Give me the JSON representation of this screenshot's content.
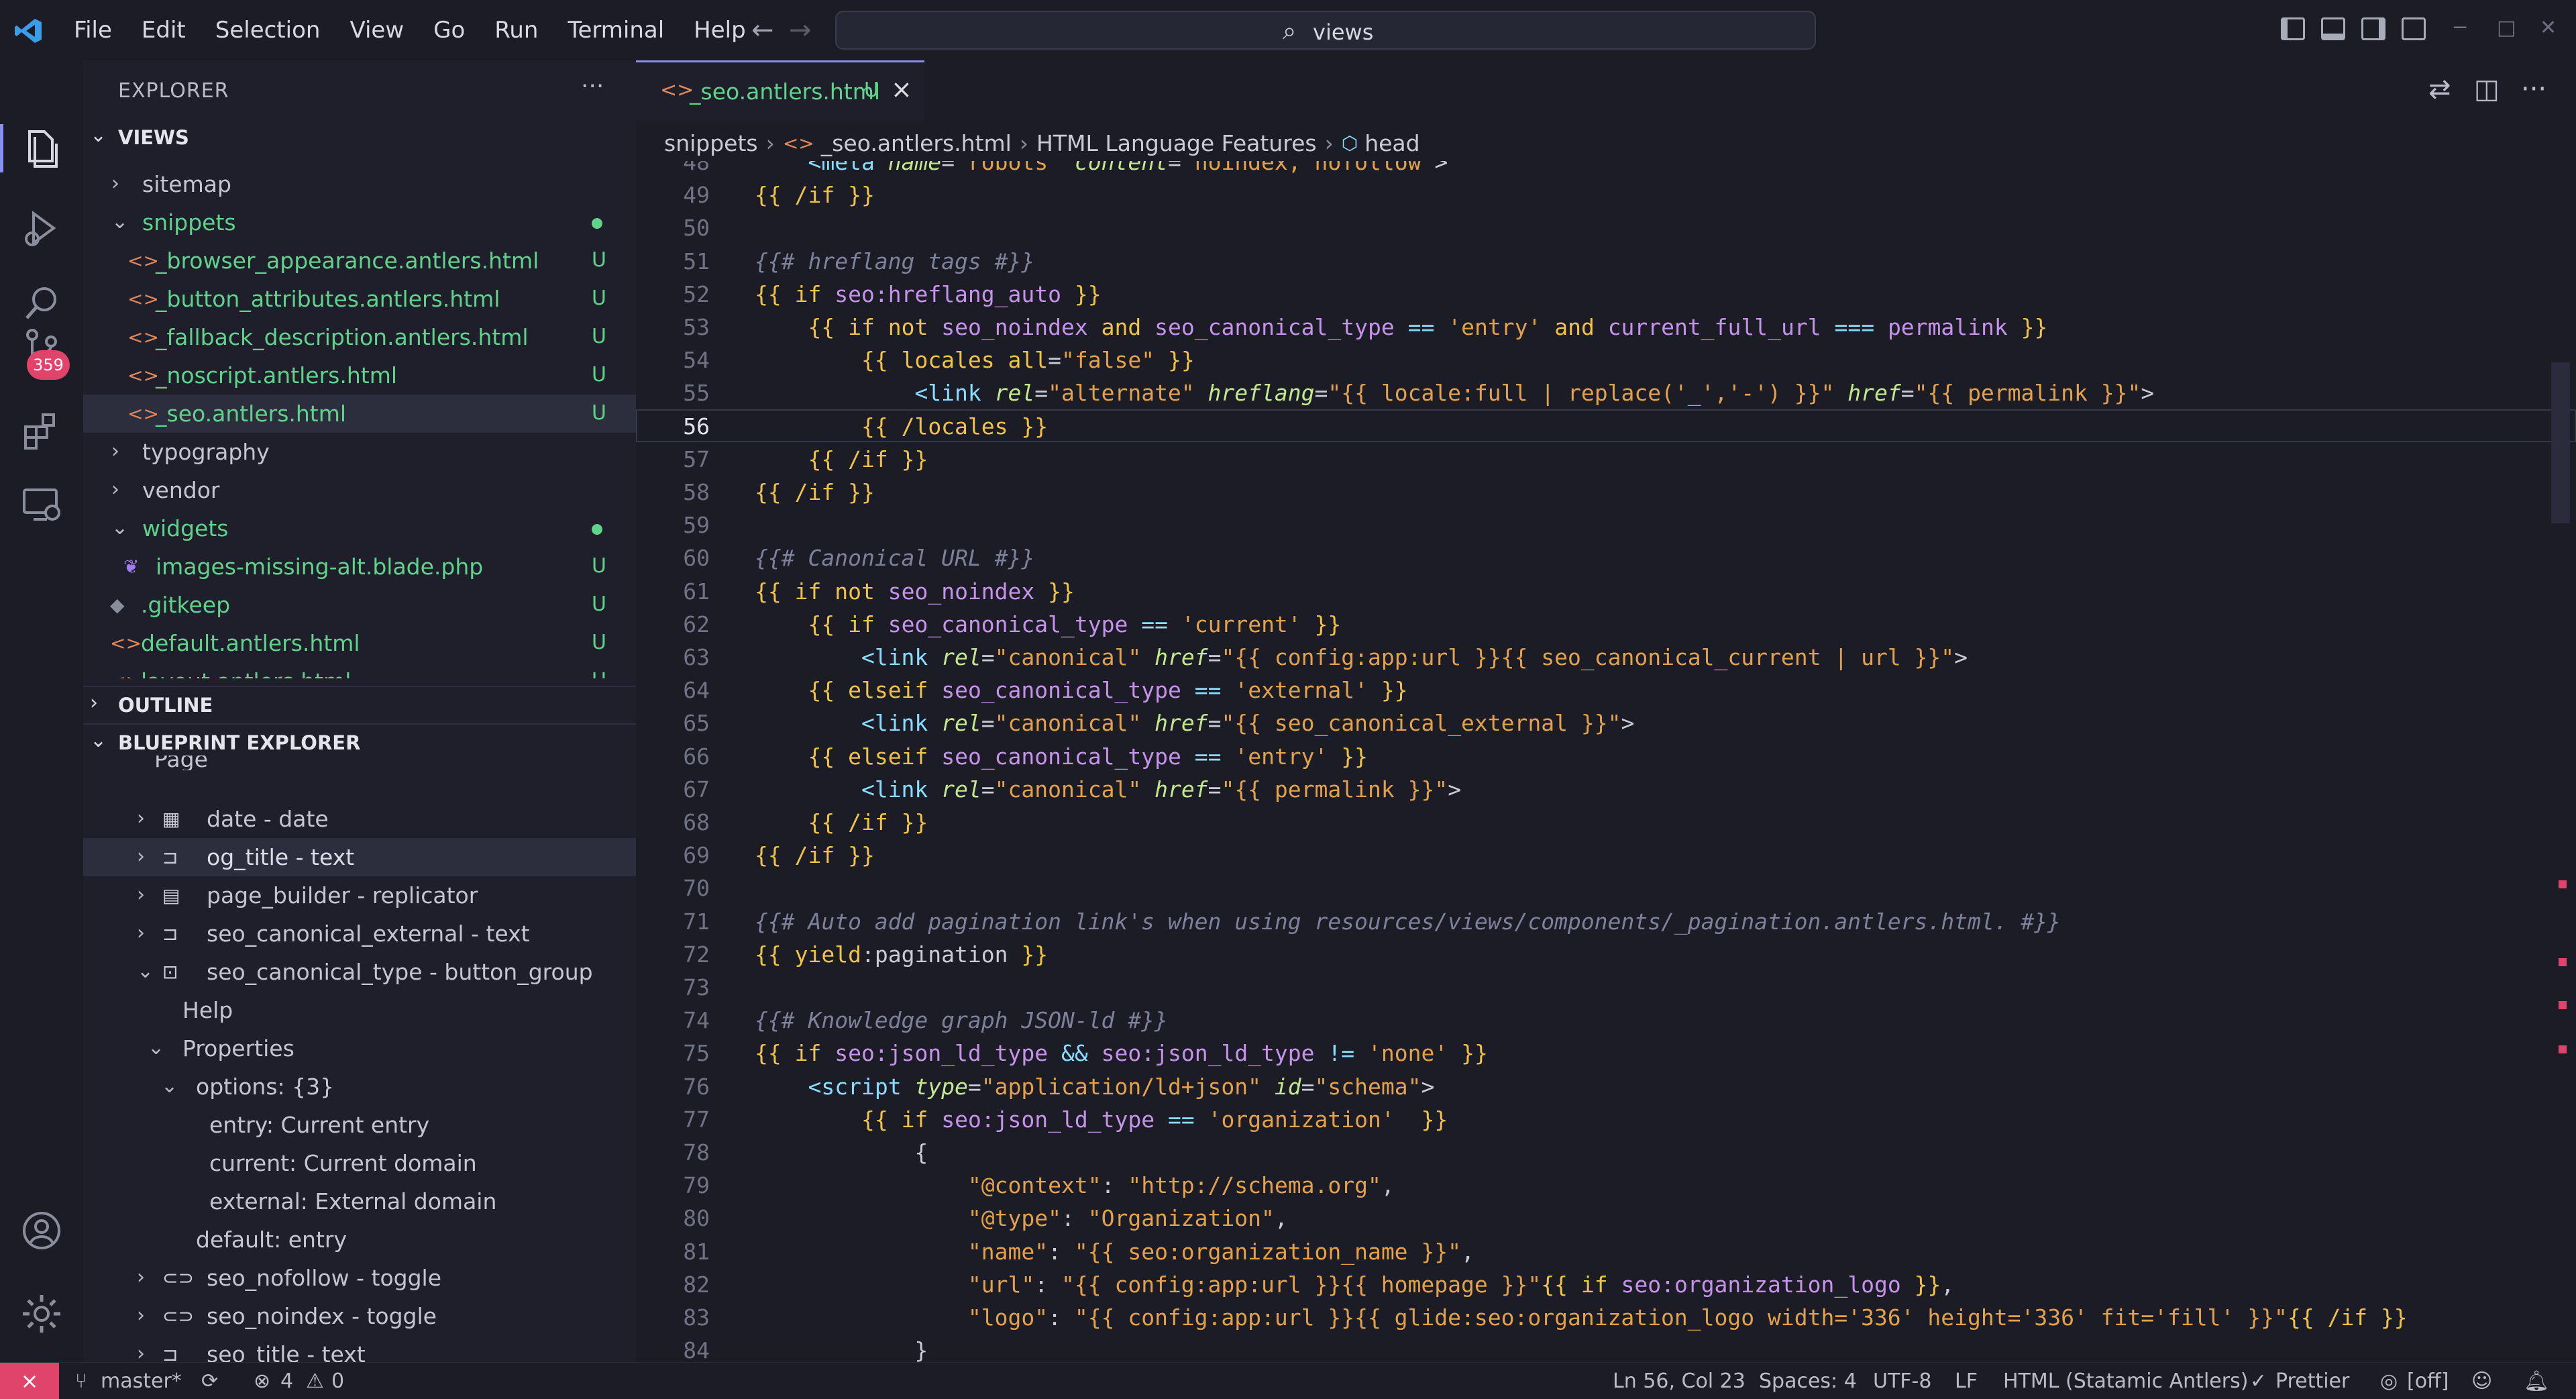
{
  "titlebar": {
    "menu": [
      "File",
      "Edit",
      "Selection",
      "View",
      "Go",
      "Run",
      "Terminal",
      "Help"
    ],
    "search_text": "views"
  },
  "activity": {
    "scm_badge": "359"
  },
  "explorer": {
    "title": "EXPLORER",
    "views_section": "VIEWS",
    "rows": [
      {
        "label": "sitemap",
        "type": "folder",
        "collapsed": true
      },
      {
        "label": "snippets",
        "type": "folder",
        "collapsed": false,
        "dot": true
      },
      {
        "label": "_browser_appearance.antlers.html",
        "type": "file",
        "status": "U"
      },
      {
        "label": "_button_attributes.antlers.html",
        "type": "file",
        "status": "U"
      },
      {
        "label": "_fallback_description.antlers.html",
        "type": "file",
        "status": "U"
      },
      {
        "label": "_noscript.antlers.html",
        "type": "file",
        "status": "U"
      },
      {
        "label": "_seo.antlers.html",
        "type": "file",
        "status": "U",
        "selected": true
      },
      {
        "label": "typography",
        "type": "folder",
        "collapsed": true
      },
      {
        "label": "vendor",
        "type": "folder",
        "collapsed": true
      },
      {
        "label": "widgets",
        "type": "folder",
        "collapsed": false,
        "dot": true
      },
      {
        "label": "images-missing-alt.blade.php",
        "type": "file",
        "status": "U"
      },
      {
        "label": ".gitkeep",
        "type": "file",
        "status": "U"
      },
      {
        "label": "default.antlers.html",
        "type": "file",
        "status": "U"
      },
      {
        "label": "layout.antlers.html",
        "type": "file",
        "status": "U"
      }
    ],
    "outline_section": "OUTLINE",
    "blueprint_section": "BLUEPRINT EXPLORER"
  },
  "blueprint": {
    "top_partial": "Page",
    "rows": [
      {
        "label": "date - date",
        "icon": "calendar-icon"
      },
      {
        "label": "og_title - text",
        "icon": "text-field-icon",
        "selected": true
      },
      {
        "label": "page_builder - replicator",
        "icon": "replicator-icon"
      },
      {
        "label": "seo_canonical_external - text",
        "icon": "text-field-icon"
      },
      {
        "label": "seo_canonical_type - button_group",
        "icon": "button-group-icon",
        "expanded": true
      },
      {
        "label": "Help"
      },
      {
        "label": "Properties"
      },
      {
        "label": "options: {3}"
      },
      {
        "label": "entry: Current entry"
      },
      {
        "label": "current: Current domain"
      },
      {
        "label": "external: External domain"
      },
      {
        "label": "default: entry"
      },
      {
        "label": "seo_nofollow - toggle",
        "icon": "toggle-icon"
      },
      {
        "label": "seo_noindex - toggle",
        "icon": "toggle-icon"
      },
      {
        "label": "seo_title - text",
        "icon": "text-field-icon"
      }
    ]
  },
  "editor": {
    "tab": {
      "label": "_seo.antlers.html",
      "status": "U"
    },
    "breadcrumb": [
      "snippets",
      "_seo.antlers.html",
      "HTML Language Features",
      "head"
    ],
    "current_line": "56",
    "lines": [
      {
        "n": "48",
        "t": "    <meta name=\"robots\" content=\"noindex, nofollow\">"
      },
      {
        "n": "49",
        "t": "{{ /if }}"
      },
      {
        "n": "50",
        "t": ""
      },
      {
        "n": "51",
        "t": "{{# hreflang tags #}}"
      },
      {
        "n": "52",
        "t": "{{ if seo:hreflang_auto }}"
      },
      {
        "n": "53",
        "t": "    {{ if not seo_noindex and seo_canonical_type == 'entry' and current_full_url === permalink }}"
      },
      {
        "n": "54",
        "t": "        {{ locales all=\"false\" }}"
      },
      {
        "n": "55",
        "t": "            <link rel=\"alternate\" hreflang=\"{{ locale:full | replace('_','-') }}\" href=\"{{ permalink }}\">"
      },
      {
        "n": "56",
        "t": "        {{ /locales }}"
      },
      {
        "n": "57",
        "t": "    {{ /if }}"
      },
      {
        "n": "58",
        "t": "{{ /if }}"
      },
      {
        "n": "59",
        "t": ""
      },
      {
        "n": "60",
        "t": "{{# Canonical URL #}}"
      },
      {
        "n": "61",
        "t": "{{ if not seo_noindex }}"
      },
      {
        "n": "62",
        "t": "    {{ if seo_canonical_type == 'current' }}"
      },
      {
        "n": "63",
        "t": "        <link rel=\"canonical\" href=\"{{ config:app:url }}{{ seo_canonical_current | url }}\">"
      },
      {
        "n": "64",
        "t": "    {{ elseif seo_canonical_type == 'external' }}"
      },
      {
        "n": "65",
        "t": "        <link rel=\"canonical\" href=\"{{ seo_canonical_external }}\">"
      },
      {
        "n": "66",
        "t": "    {{ elseif seo_canonical_type == 'entry' }}"
      },
      {
        "n": "67",
        "t": "        <link rel=\"canonical\" href=\"{{ permalink }}\">"
      },
      {
        "n": "68",
        "t": "    {{ /if }}"
      },
      {
        "n": "69",
        "t": "{{ /if }}"
      },
      {
        "n": "70",
        "t": ""
      },
      {
        "n": "71",
        "t": "{{# Auto add pagination link's when using resources/views/components/_pagination.antlers.html. #}}"
      },
      {
        "n": "72",
        "t": "{{ yield:pagination }}"
      },
      {
        "n": "73",
        "t": ""
      },
      {
        "n": "74",
        "t": "{{# Knowledge graph JSON-ld #}}"
      },
      {
        "n": "75",
        "t": "{{ if seo:json_ld_type && seo:json_ld_type != 'none' }}"
      },
      {
        "n": "76",
        "t": "    <script type=\"application/ld+json\" id=\"schema\">"
      },
      {
        "n": "77",
        "t": "        {{ if seo:json_ld_type == 'organization'  }}"
      },
      {
        "n": "78",
        "t": "            {"
      },
      {
        "n": "79",
        "t": "                \"@context\": \"http://schema.org\","
      },
      {
        "n": "80",
        "t": "                \"@type\": \"Organization\","
      },
      {
        "n": "81",
        "t": "                \"name\": \"{{ seo:organization_name }}\","
      },
      {
        "n": "82",
        "t": "                \"url\": \"{{ config:app:url }}{{ homepage }}\"{{ if seo:organization_logo }},"
      },
      {
        "n": "83",
        "t": "                \"logo\": \"{{ config:app:url }}{{ glide:seo:organization_logo width='336' height='336' fit='fill' }}\"{{ /if }}"
      },
      {
        "n": "84",
        "t": "            }"
      }
    ]
  },
  "statusbar": {
    "branch": "master*",
    "errors": "4",
    "warnings": "0",
    "cursor": "Ln 56, Col 23",
    "spaces": "Spaces: 4",
    "encoding": "UTF-8",
    "eol": "LF",
    "language": "HTML (Statamic Antlers)",
    "formatter": "Prettier",
    "copilot": "[off]"
  }
}
